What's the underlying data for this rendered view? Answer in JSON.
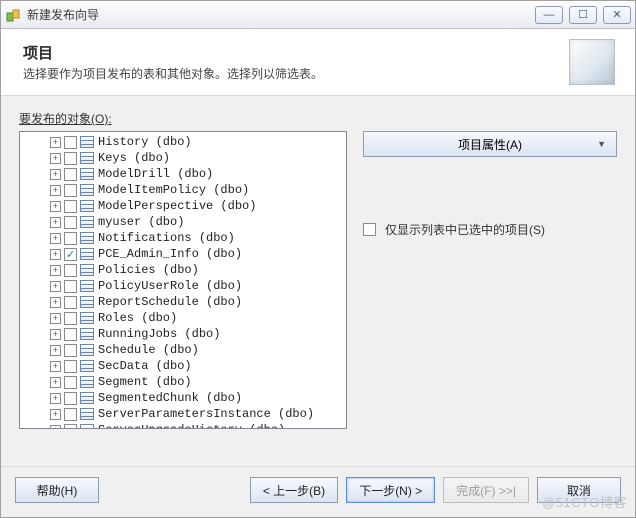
{
  "window": {
    "title": "新建发布向导"
  },
  "header": {
    "heading": "项目",
    "subtext": "选择要作为项目发布的表和其他对象。选择列以筛选表。"
  },
  "body_label": "要发布的对象(O):",
  "tree": [
    {
      "label": "History (dbo)",
      "checked": false
    },
    {
      "label": "Keys (dbo)",
      "checked": false
    },
    {
      "label": "ModelDrill (dbo)",
      "checked": false
    },
    {
      "label": "ModelItemPolicy (dbo)",
      "checked": false
    },
    {
      "label": "ModelPerspective (dbo)",
      "checked": false
    },
    {
      "label": "myuser (dbo)",
      "checked": false
    },
    {
      "label": "Notifications (dbo)",
      "checked": false
    },
    {
      "label": "PCE_Admin_Info (dbo)",
      "checked": true
    },
    {
      "label": "Policies (dbo)",
      "checked": false
    },
    {
      "label": "PolicyUserRole (dbo)",
      "checked": false
    },
    {
      "label": "ReportSchedule (dbo)",
      "checked": false
    },
    {
      "label": "Roles (dbo)",
      "checked": false
    },
    {
      "label": "RunningJobs (dbo)",
      "checked": false
    },
    {
      "label": "Schedule (dbo)",
      "checked": false
    },
    {
      "label": "SecData (dbo)",
      "checked": false
    },
    {
      "label": "Segment (dbo)",
      "checked": false
    },
    {
      "label": "SegmentedChunk (dbo)",
      "checked": false
    },
    {
      "label": "ServerParametersInstance (dbo)",
      "checked": false
    },
    {
      "label": "ServerUpgradeHistory (dbo)",
      "checked": false
    }
  ],
  "right": {
    "properties_button": "项目属性(A)",
    "show_selected_label": "仅显示列表中已选中的项目(S)",
    "show_selected_checked": false
  },
  "buttons": {
    "help": "帮助(H)",
    "back": "< 上一步(B)",
    "next": "下一步(N) >",
    "finish": "完成(F) >>|",
    "cancel": "取消"
  },
  "watermark": "@51CTO博客"
}
